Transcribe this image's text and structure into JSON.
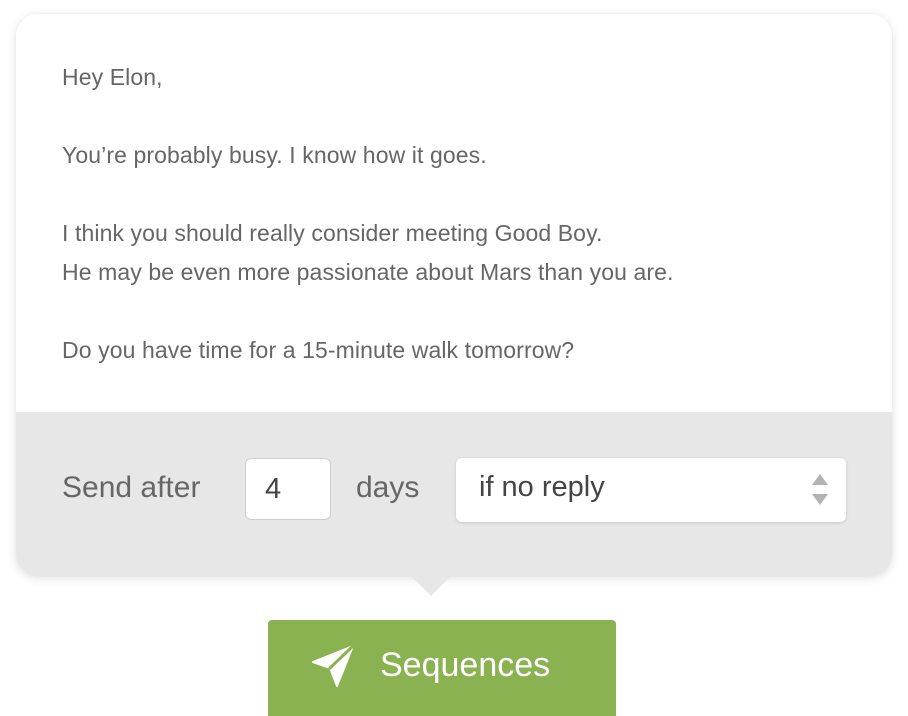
{
  "email": {
    "greeting": "Hey Elon,",
    "paragraph1": "You’re probably busy. I know how it goes.",
    "paragraph2_line1": "I think you should really consider meeting Good Boy.",
    "paragraph2_line2": "He may be even more passionate about Mars than you are.",
    "paragraph3": "Do you have time for a 15-minute walk tomorrow?"
  },
  "schedule": {
    "send_after_label": "Send after",
    "days_value": "4",
    "days_label": "days",
    "condition_selected": "if no reply",
    "arrows_icon": "select-arrows-icon"
  },
  "cta": {
    "label": "Sequences",
    "icon": "paper-plane-icon",
    "color": "#8ab251"
  },
  "colors": {
    "text": "#666666",
    "controls_bg": "#e7e7e7",
    "card_bg": "#ffffff"
  }
}
